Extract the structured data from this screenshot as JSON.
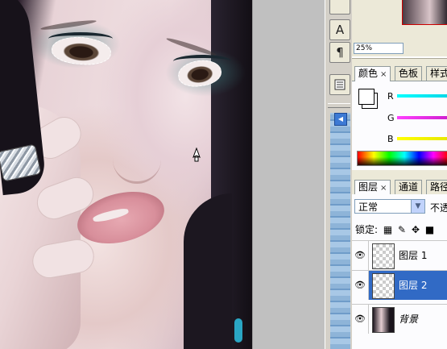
{
  "navigator": {
    "zoom": "25%"
  },
  "color_panel": {
    "tabs": [
      {
        "label": "颜色",
        "close": "×"
      },
      {
        "label": "色板"
      },
      {
        "label": "样式"
      }
    ],
    "channels": [
      {
        "label": "R",
        "color": "#00e0e8"
      },
      {
        "label": "G",
        "color": "#e040e0"
      },
      {
        "label": "B",
        "color": "#f0f000"
      }
    ]
  },
  "layers_panel": {
    "tabs": [
      {
        "label": "图层",
        "close": "×"
      },
      {
        "label": "通道"
      },
      {
        "label": "路径"
      }
    ],
    "blend_mode": "正常",
    "opacity_label": "不透",
    "lock_label": "锁定:",
    "layers": [
      {
        "name": "图层 1",
        "selected": false
      },
      {
        "name": "图层 2",
        "selected": true
      },
      {
        "name": "背景",
        "selected": false
      }
    ]
  },
  "colors": {
    "selection": "#316ac5",
    "panel_bg": "#ece9d8"
  }
}
